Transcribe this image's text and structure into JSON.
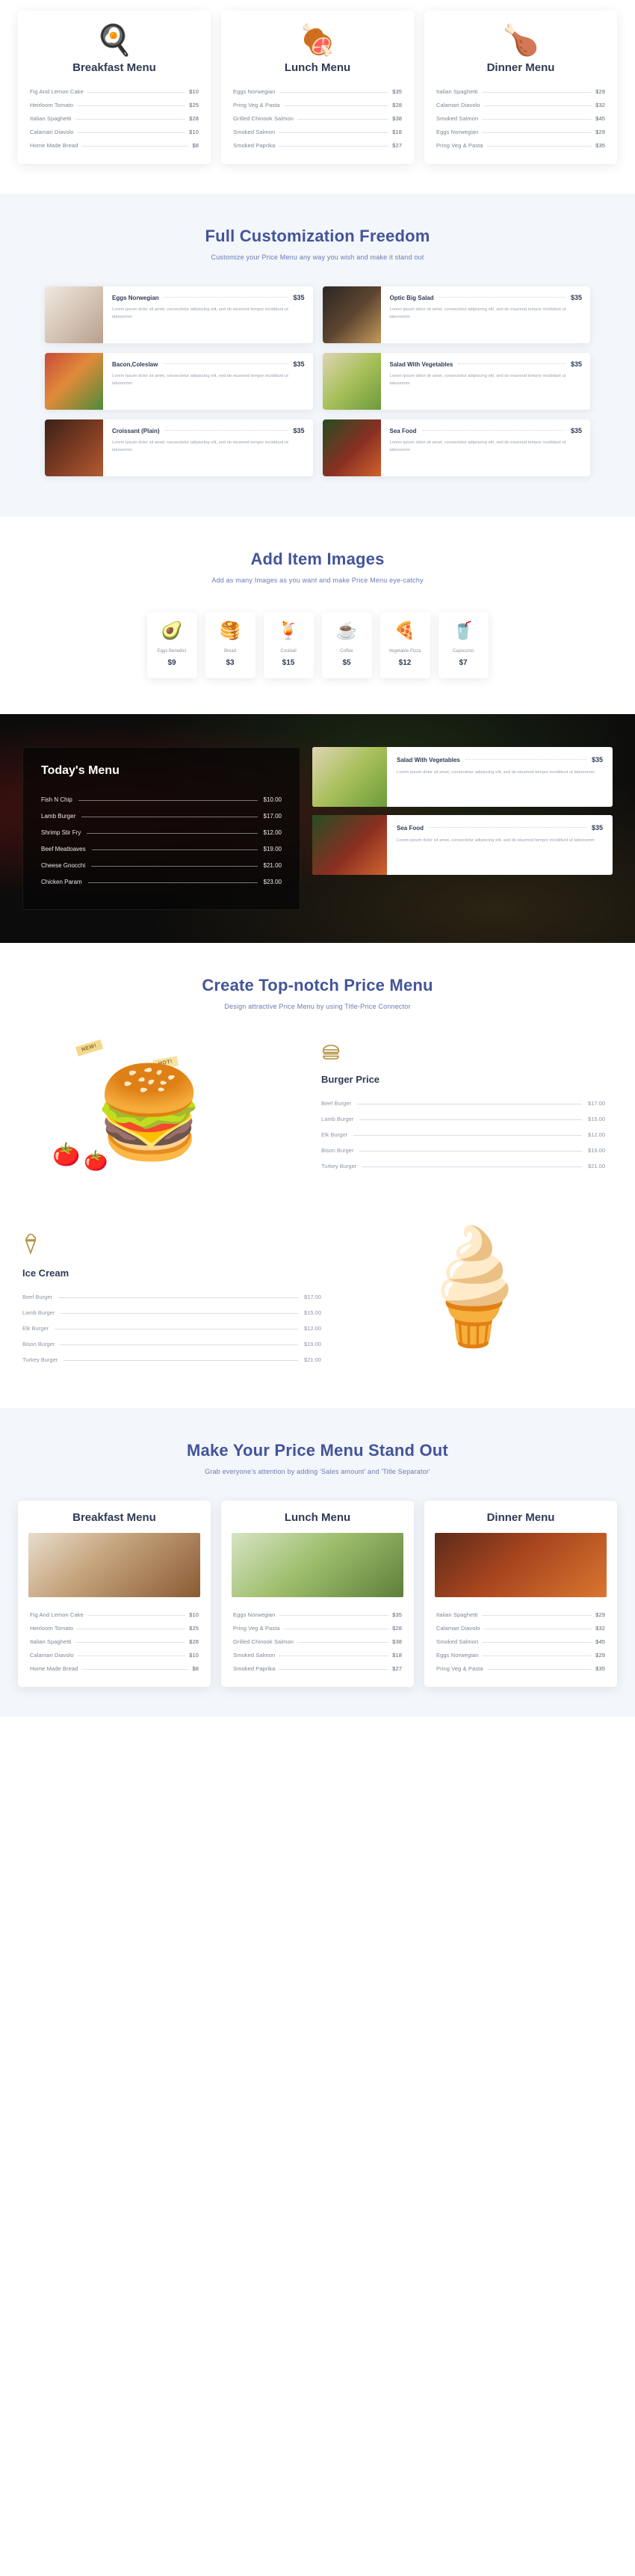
{
  "menu_cards": [
    {
      "title": "Breakfast Menu",
      "emoji": "🍳",
      "items": [
        {
          "name": "Fig And Lemon Cake",
          "price": "$10"
        },
        {
          "name": "Heirloom Tomato",
          "price": "$25"
        },
        {
          "name": "Italian Spaghetti",
          "price": "$28"
        },
        {
          "name": "Calamari Diavolo",
          "price": "$10"
        },
        {
          "name": "Home Made Bread",
          "price": "$8"
        }
      ]
    },
    {
      "title": "Lunch Menu",
      "emoji": "🍖",
      "items": [
        {
          "name": "Eggs Norwegian",
          "price": "$35"
        },
        {
          "name": "Pring Veg & Pasta",
          "price": "$28"
        },
        {
          "name": "Grilled Chinook Salmon",
          "price": "$38"
        },
        {
          "name": "Smoked Salmon",
          "price": "$18"
        },
        {
          "name": "Smoked Paprika",
          "price": "$27"
        }
      ]
    },
    {
      "title": "Dinner Menu",
      "emoji": "🍗",
      "items": [
        {
          "name": "Italian Spaghetti",
          "price": "$29"
        },
        {
          "name": "Calamari Diavolo",
          "price": "$32"
        },
        {
          "name": "Smoked Salmon",
          "price": "$45"
        },
        {
          "name": "Eggs Norwegian",
          "price": "$29"
        },
        {
          "name": "Pring Veg & Pasta",
          "price": "$35"
        }
      ]
    }
  ],
  "customization": {
    "title": "Full Customization Freedom",
    "subtitle": "Customize your Price Menu any way you wish and make it stand out",
    "description": "Lorem ipsum dolor sit amet, consectetur adipiscing elit, sed do eiusmod tempor incididunt ut labooomm",
    "items": [
      {
        "name": "Eggs Norwegian",
        "price": "$35",
        "thumb": "th-fig"
      },
      {
        "name": "Optic Big Salad",
        "price": "$35",
        "thumb": "th-pan"
      },
      {
        "name": "Bacon,Coleslaw",
        "price": "$35",
        "thumb": "th-salad"
      },
      {
        "name": "Salad With Vegetables",
        "price": "$35",
        "thumb": "th-veg"
      },
      {
        "name": "Croissant (Plain)",
        "price": "$35",
        "thumb": "th-meat"
      },
      {
        "name": "Sea Food",
        "price": "$35",
        "thumb": "th-sea"
      }
    ]
  },
  "item_images": {
    "title": "Add Item Images",
    "subtitle": "Add as many Images as you want and make Price Menu eye-catchy",
    "tiles": [
      {
        "name": "Eggs Benedict",
        "price": "$9",
        "emoji": "🥑"
      },
      {
        "name": "Bread",
        "price": "$3",
        "emoji": "🥞"
      },
      {
        "name": "Cocktail",
        "price": "$15",
        "emoji": "🍹"
      },
      {
        "name": "Coffee",
        "price": "$5",
        "emoji": "☕"
      },
      {
        "name": "Vegetable Pizza",
        "price": "$12",
        "emoji": "🍕"
      },
      {
        "name": "Capuccino",
        "price": "$7",
        "emoji": "🥤"
      }
    ]
  },
  "todays_menu": {
    "title": "Today's Menu",
    "items": [
      {
        "name": "Fish N Chip",
        "price": "$10.00"
      },
      {
        "name": "Lamb Burger",
        "price": "$17.00"
      },
      {
        "name": "Shrimp Stir Fry",
        "price": "$12.00"
      },
      {
        "name": "Beef Meatloaves",
        "price": "$19.00"
      },
      {
        "name": "Cheese Gnocchi",
        "price": "$21.00"
      },
      {
        "name": "Chicken Param",
        "price": "$23.00"
      }
    ],
    "cards": [
      {
        "name": "Salad With Vegetables",
        "price": "$35",
        "thumb": "th-veg",
        "desc": "Lorem ipsum dolor sit amet, consectetur adipiscing elit, sed do eiusmod tempor incididunt ut labooomm"
      },
      {
        "name": "Sea Food",
        "price": "$35",
        "thumb": "th-sea",
        "desc": "Lorem ipsum dolor sit amet, consectetur adipiscing elit, sed do eiusmod tempor incididunt ut labooomm"
      }
    ]
  },
  "topnotch": {
    "title": "Create Top-notch Price Menu",
    "subtitle": "Design attractive Price Menu by using Title-Price Connector",
    "tag_new": "NEW!",
    "tag_hot": "HOT!",
    "burger": {
      "panel_title": "Burger Price",
      "icon": "burger-icon",
      "items": [
        {
          "name": "Beef Burger",
          "price": "$17.00"
        },
        {
          "name": "Lamb Burger",
          "price": "$15.00"
        },
        {
          "name": "Elk Burger",
          "price": "$12.00"
        },
        {
          "name": "Bison Burger",
          "price": "$19.00"
        },
        {
          "name": "Turkey Burger",
          "price": "$21.00"
        }
      ]
    },
    "icecream": {
      "panel_title": "Ice Cream",
      "icon": "ice-cream-cone-icon",
      "items": [
        {
          "name": "Beef Burger",
          "price": "$17.00"
        },
        {
          "name": "Lamb Burger",
          "price": "$15.00"
        },
        {
          "name": "Elk Burger",
          "price": "$12.00"
        },
        {
          "name": "Bison Burger",
          "price": "$19.00"
        },
        {
          "name": "Turkey Burger",
          "price": "$21.00"
        }
      ]
    }
  },
  "standout": {
    "title": "Make Your Price Menu Stand Out",
    "subtitle": "Grab everyone's attention by adding 'Sales amount' and 'Title Separator'",
    "cards": [
      {
        "title": "Breakfast Menu",
        "photo": "ph-break",
        "items": [
          {
            "name": "Fig And Lemon Cake",
            "price": "$10"
          },
          {
            "name": "Heirloom Tomato",
            "price": "$25"
          },
          {
            "name": "Italian Spaghetti",
            "price": "$28"
          },
          {
            "name": "Calamari Diavolo",
            "price": "$10"
          },
          {
            "name": "Home Made Bread",
            "price": "$8"
          }
        ]
      },
      {
        "title": "Lunch Menu",
        "photo": "ph-lunch",
        "items": [
          {
            "name": "Eggs Norwegian",
            "price": "$35"
          },
          {
            "name": "Pring Veg & Pasta",
            "price": "$28"
          },
          {
            "name": "Grilled Chinook Salmon",
            "price": "$38"
          },
          {
            "name": "Smoked Salmon",
            "price": "$18"
          },
          {
            "name": "Smoked Paprika",
            "price": "$27"
          }
        ]
      },
      {
        "title": "Dinner Menu",
        "photo": "ph-dinner",
        "items": [
          {
            "name": "Italian Spaghetti",
            "price": "$29"
          },
          {
            "name": "Calamari Diavolo",
            "price": "$32"
          },
          {
            "name": "Smoked Salmon",
            "price": "$45"
          },
          {
            "name": "Eggs Norwegian",
            "price": "$29"
          },
          {
            "name": "Pring Veg & Pasta",
            "price": "$35"
          }
        ]
      }
    ]
  },
  "colors": {
    "heading": "#43549a",
    "subtext": "#6b7bb5",
    "dark_text": "#2f3b54",
    "muted": "#8d94a4",
    "gold": "#b08a35",
    "section_bg": "#f3f6fa"
  }
}
